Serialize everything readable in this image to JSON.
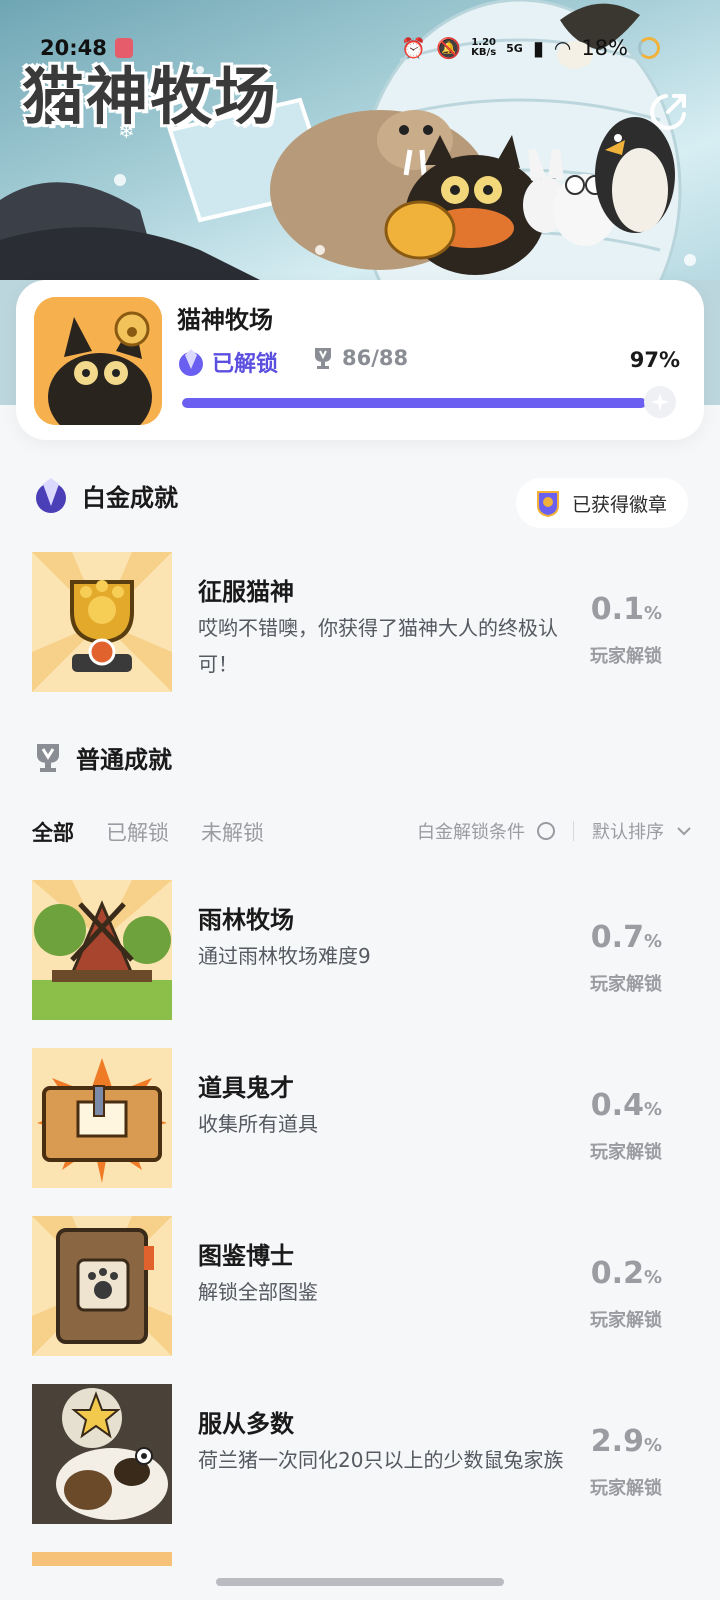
{
  "status_bar": {
    "time": "20:48",
    "net_speed_top": "1.20",
    "net_speed_bottom": "KB/s",
    "signal": "5G",
    "battery": "18%"
  },
  "banner": {
    "title": "猫神牧场"
  },
  "game": {
    "name": "猫神牧场",
    "unlock_status": "已解锁",
    "trophy_count": "86/88",
    "percent": "97%",
    "progress": 0.97
  },
  "platinum": {
    "heading": "白金成就",
    "badge_button": "已获得徽章",
    "item": {
      "title": "征服猫神",
      "desc": "哎哟不错噢，你获得了猫神大人的终极认可！",
      "rate": "0.1",
      "rate_unit": "%",
      "rate_label": "玩家解锁"
    }
  },
  "normal": {
    "heading": "普通成就",
    "tabs": [
      "全部",
      "已解锁",
      "未解锁"
    ],
    "platinum_condition": "白金解锁条件",
    "sort_label": "默认排序",
    "items": [
      {
        "title": "雨林牧场",
        "desc": "通过雨林牧场难度9",
        "rate": "0.7",
        "rate_unit": "%",
        "rate_label": "玩家解锁"
      },
      {
        "title": "道具鬼才",
        "desc": "收集所有道具",
        "rate": "0.4",
        "rate_unit": "%",
        "rate_label": "玩家解锁"
      },
      {
        "title": "图鉴博士",
        "desc": "解锁全部图鉴",
        "rate": "0.2",
        "rate_unit": "%",
        "rate_label": "玩家解锁"
      },
      {
        "title": "服从多数",
        "desc": "荷兰猪一次同化20只以上的少数鼠兔家族",
        "rate": "2.9",
        "rate_unit": "%",
        "rate_label": "玩家解锁"
      }
    ]
  },
  "colors": {
    "accent": "#6a5ff0",
    "accent_text": "#5b4fe0",
    "muted": "#9a9ca1"
  }
}
